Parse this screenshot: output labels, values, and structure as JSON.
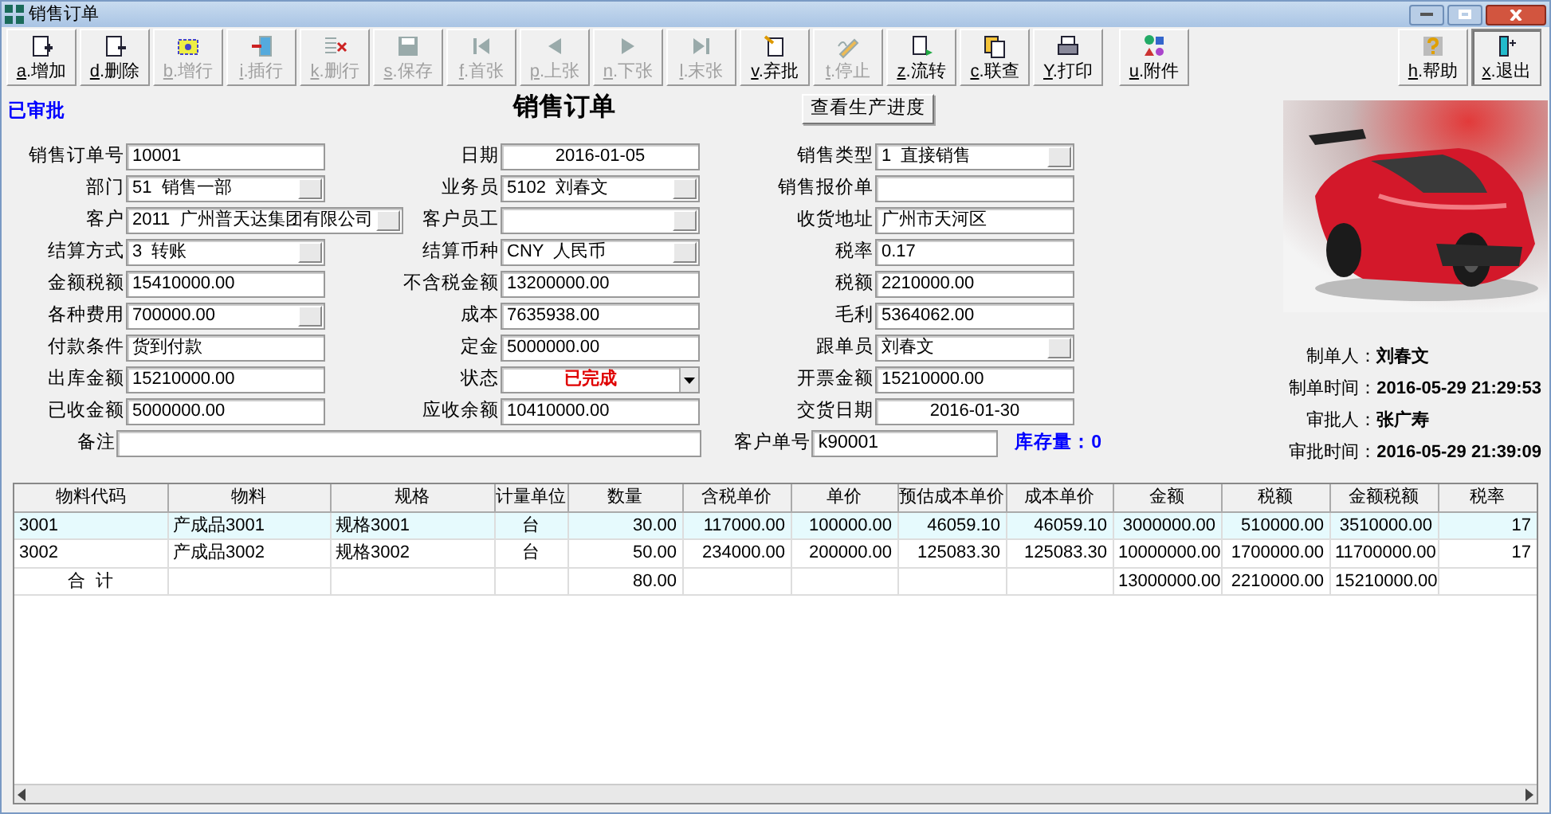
{
  "window": {
    "title": "销售订单"
  },
  "toolbar": [
    {
      "label": "a.增加",
      "disabled": false
    },
    {
      "label": "d.删除",
      "disabled": false
    },
    {
      "label": "b.增行",
      "disabled": true
    },
    {
      "label": "i.插行",
      "disabled": true
    },
    {
      "label": "k.删行",
      "disabled": true
    },
    {
      "label": "s.保存",
      "disabled": true
    },
    {
      "label": "f.首张",
      "disabled": true
    },
    {
      "label": "p.上张",
      "disabled": true
    },
    {
      "label": "n.下张",
      "disabled": true
    },
    {
      "label": "l.末张",
      "disabled": true
    },
    {
      "label": "v.弃批",
      "disabled": false
    },
    {
      "label": "t.停止",
      "disabled": true
    },
    {
      "label": "z.流转",
      "disabled": false
    },
    {
      "label": "c.联查",
      "disabled": false
    },
    {
      "label": "Y.打印",
      "disabled": false
    },
    {
      "label": "u.附件",
      "disabled": false
    }
  ],
  "toolbar_right": [
    {
      "label": "h.帮助",
      "disabled": false
    },
    {
      "label": "x.退出",
      "disabled": false
    }
  ],
  "status_badge": "已审批",
  "form_title": "销售订单",
  "progress_button": "查看生产进度",
  "rows": [
    [
      {
        "label": "销售订单号",
        "value": "10001",
        "kind": "text"
      },
      {
        "label": "日期",
        "value": "2016-01-05",
        "kind": "date"
      },
      {
        "label": "销售类型",
        "value": "1  直接销售",
        "kind": "lookup"
      }
    ],
    [
      {
        "label": "部门",
        "value": "51  销售一部",
        "kind": "lookup"
      },
      {
        "label": "业务员",
        "value": "5102  刘春文",
        "kind": "lookup"
      },
      {
        "label": "销售报价单",
        "kind": "text"
      }
    ],
    [
      {
        "label": "客户",
        "value": "2011  广州普天达集团有限公司",
        "kind": "lookup"
      },
      {
        "label": "客户员工",
        "kind": "lookup"
      },
      {
        "label": "收货地址",
        "value": "广州市天河区",
        "kind": "text"
      }
    ],
    [
      {
        "label": "结算方式",
        "value": "3  转账",
        "kind": "lookup"
      },
      {
        "label": "结算币种",
        "value": "CNY  人民币",
        "kind": "lookup"
      },
      {
        "label": "税率",
        "value": "0.17",
        "kind": "text"
      }
    ],
    [
      {
        "label": "金额税额",
        "value": "15410000.00",
        "kind": "text"
      },
      {
        "label": "不含税金额",
        "value": "13200000.00",
        "kind": "text"
      },
      {
        "label": "税额",
        "value": "2210000.00",
        "kind": "text"
      }
    ],
    [
      {
        "label": "各种费用",
        "value": "700000.00",
        "kind": "lookup"
      },
      {
        "label": "成本",
        "value": "7635938.00",
        "kind": "text"
      },
      {
        "label": "毛利",
        "value": "5364062.00",
        "kind": "text"
      }
    ],
    [
      {
        "label": "付款条件",
        "value": "货到付款",
        "kind": "text"
      },
      {
        "label": "定金",
        "value": "5000000.00",
        "kind": "text"
      },
      {
        "label": "跟单员",
        "value": "刘春文",
        "kind": "lookup"
      }
    ],
    [
      {
        "label": "出库金额",
        "value": "15210000.00",
        "kind": "text"
      },
      {
        "label": "状态",
        "value": "已完成",
        "kind": "status"
      },
      {
        "label": "开票金额",
        "value": "15210000.00",
        "kind": "text"
      }
    ],
    [
      {
        "label": "已收金额",
        "value": "5000000.00",
        "kind": "text"
      },
      {
        "label": "应收余额",
        "value": "10410000.00",
        "kind": "text"
      },
      {
        "label": "交货日期",
        "value": "2016-01-30",
        "kind": "date"
      }
    ]
  ],
  "remarks": {
    "label": "备注"
  },
  "customer_no": {
    "label": "客户单号",
    "value": "k90001"
  },
  "stock": "库存量：0",
  "info": [
    {
      "label": "制单人：",
      "value": "刘春文"
    },
    {
      "label": "制单时间：",
      "value": "2016-05-29 21:29:53"
    },
    {
      "label": "审批人：",
      "value": "张广寿"
    },
    {
      "label": "审批时间：",
      "value": "2016-05-29 21:39:09"
    }
  ],
  "table": {
    "columns": [
      "物料代码",
      "物料",
      "规格",
      "计量单位",
      "数量",
      "含税单价",
      "单价",
      "预估成本单价",
      "成本单价",
      "金额",
      "税额",
      "金额税额",
      "税率"
    ],
    "rows": [
      {
        "selected": true,
        "cells": [
          "3001",
          "产成品3001",
          "规格3001",
          "台",
          "30.00",
          "117000.00",
          "100000.00",
          "46059.10",
          "46059.10",
          "3000000.00",
          "510000.00",
          "3510000.00",
          "17"
        ]
      },
      {
        "selected": false,
        "cells": [
          "3002",
          "产成品3002",
          "规格3002",
          "台",
          "50.00",
          "234000.00",
          "200000.00",
          "125083.30",
          "125083.30",
          "10000000.00",
          "1700000.00",
          "11700000.00",
          "17"
        ]
      }
    ],
    "total": {
      "label": "合  计",
      "quantity": "80.00",
      "amount": "13000000.00",
      "tax": "2210000.00",
      "amount_with_tax": "15210000.00"
    }
  }
}
